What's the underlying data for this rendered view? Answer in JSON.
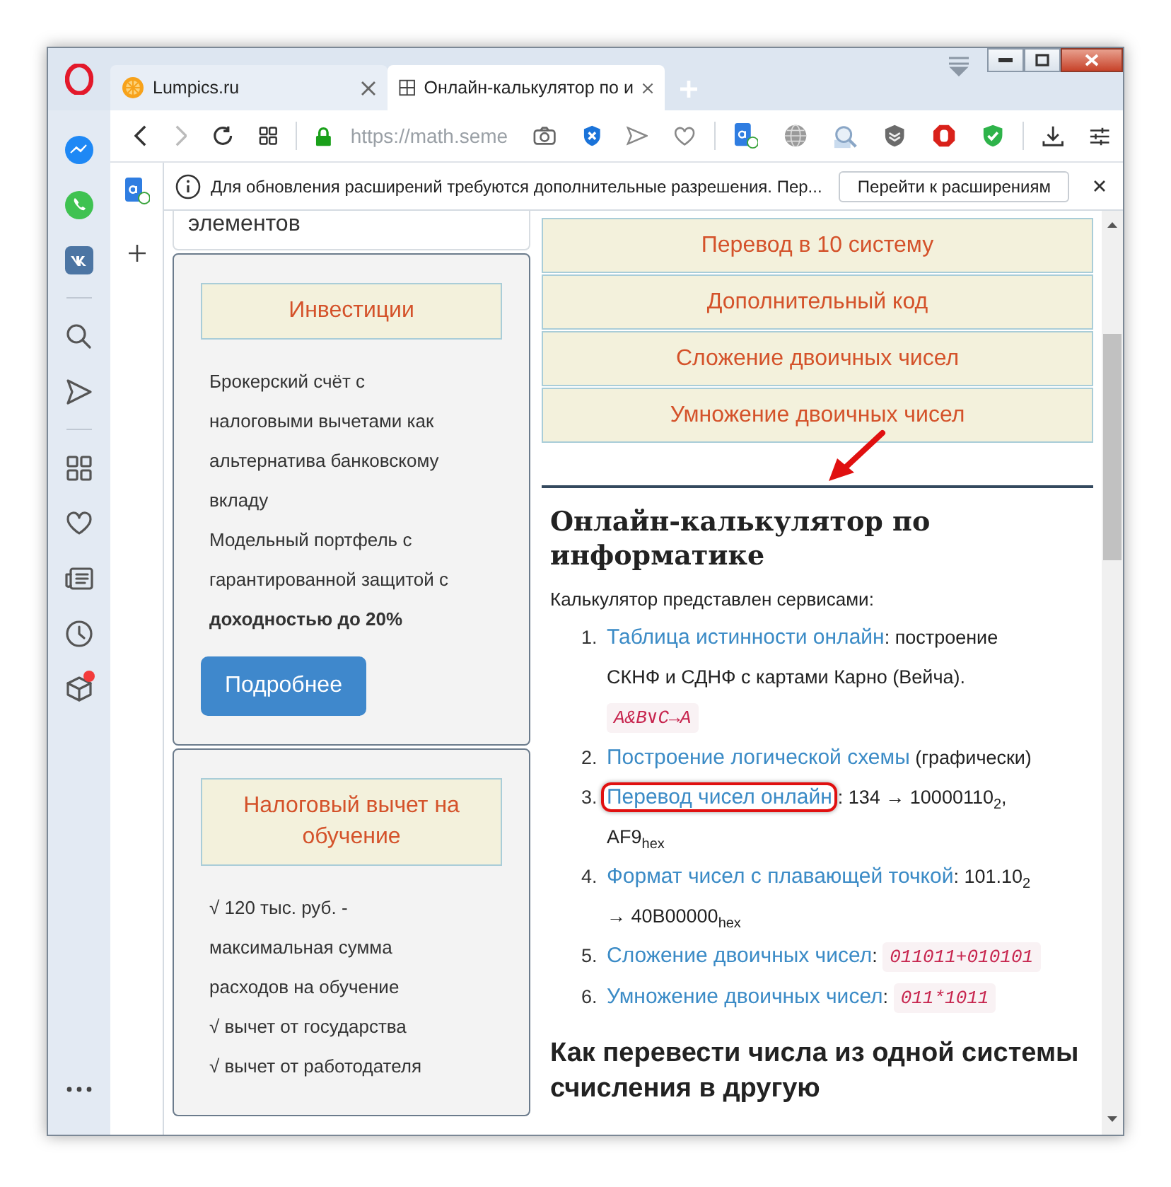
{
  "tabs": [
    {
      "title": "Lumpics.ru",
      "kind": "site",
      "selected": false
    },
    {
      "title": "Онлайн-калькулятор по и",
      "kind": "grid",
      "selected": true
    }
  ],
  "address_bar": {
    "url": "https://math.seme"
  },
  "sidebar": {
    "items": [
      {
        "kind": "messenger",
        "badge": false
      },
      {
        "kind": "whatsapp",
        "badge": false
      },
      {
        "kind": "vk",
        "badge": false
      },
      {
        "kind": "separator",
        "badge": false
      },
      {
        "kind": "search",
        "badge": false
      },
      {
        "kind": "send",
        "badge": false
      },
      {
        "kind": "separator",
        "badge": false
      },
      {
        "kind": "grid",
        "badge": false
      },
      {
        "kind": "heart",
        "badge": false
      },
      {
        "kind": "news",
        "badge": false
      },
      {
        "kind": "clock",
        "badge": false
      },
      {
        "kind": "cube",
        "badge": true
      }
    ]
  },
  "notification": {
    "text": "Для обновления расширений требуются дополнительные разрешения. Пер...",
    "button": "Перейти к расширениям"
  },
  "left_column": {
    "top_card_text": "элементов",
    "cards": [
      {
        "title": "Инвестиции",
        "paragraphs": [
          "Брокерский счёт с налоговыми вычетами как альтернатива банковскому вкладу",
          "Модельный портфель с гарантированной защитой с **доходностью до 20%**"
        ],
        "button": "Подробнее"
      },
      {
        "title": "Налоговый вычет на обучение",
        "paragraphs": [
          "√ 120 тыс. руб. - максимальная сумма расходов на обучение",
          "√ вычет от государства",
          "√ вычет от работодателя"
        ]
      }
    ]
  },
  "right_column": {
    "menu_buttons": [
      "Перевод в 10 систему",
      "Дополнительный код",
      "Сложение двоичных чисел",
      "Умножение двоичных чисел"
    ],
    "heading": "Онлайн-калькулятор по информатике",
    "intro": "Калькулятор представлен сервисами:",
    "services": [
      {
        "number": "1.",
        "link": "Таблица истинности онлайн",
        "text": ": построение СКНФ и СДНФ с картами Карно (Вейча).",
        "code": "A&B∨C→A",
        "highlighted": false
      },
      {
        "number": "2.",
        "link": "Построение логической схемы",
        "text": " (графически)",
        "highlighted": false
      },
      {
        "number": "3.",
        "link": "Перевод чисел онлайн",
        "text": ": 134 → 10000110$_{2}$, AF9$_{hex}$",
        "highlighted": true
      },
      {
        "number": "4.",
        "link": "Формат чисел с плавающей точкой",
        "text": ": 101.10$_{2}$ → 40B00000$_{hex}$",
        "highlighted": false
      },
      {
        "number": "5.",
        "link": "Сложение двоичных чисел",
        "text": ":",
        "code": "011011+010101",
        "highlighted": false
      },
      {
        "number": "6.",
        "link": "Умножение двоичных чисел",
        "text": ":",
        "code": "011*1011",
        "highlighted": false
      }
    ],
    "subheading": "Как перевести числа из одной системы счисления в другую"
  }
}
